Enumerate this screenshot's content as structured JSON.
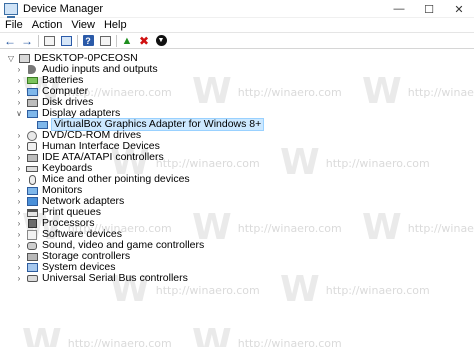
{
  "window": {
    "title": "Device Manager",
    "controls": {
      "minimize": "—",
      "maximize": "☐",
      "close": "✕"
    }
  },
  "menubar": {
    "items": [
      {
        "label": "File"
      },
      {
        "label": "Action"
      },
      {
        "label": "View"
      },
      {
        "label": "Help"
      }
    ]
  },
  "toolbar": {
    "buttons": [
      "back-arrow-icon",
      "forward-arrow-icon",
      "properties-icon",
      "show-hidden-icon",
      "help-icon",
      "scan-hardware-icon",
      "update-driver-icon",
      "uninstall-icon",
      "disable-icon"
    ]
  },
  "tree": {
    "root": "DESKTOP-0PCEOSN",
    "categories": [
      {
        "label": "Audio inputs and outputs",
        "icon": "speaker-icon"
      },
      {
        "label": "Batteries",
        "icon": "battery-icon"
      },
      {
        "label": "Computer",
        "icon": "computer-icon"
      },
      {
        "label": "Disk drives",
        "icon": "disk-icon"
      },
      {
        "label": "Display adapters",
        "icon": "display-adapter-icon"
      },
      {
        "label": "VirtualBox Graphics Adapter for Windows 8+",
        "icon": "display-adapter-icon"
      },
      {
        "label": "DVD/CD-ROM drives",
        "icon": "cdrom-icon"
      },
      {
        "label": "Human Interface Devices",
        "icon": "hid-icon"
      },
      {
        "label": "IDE ATA/ATAPI controllers",
        "icon": "ide-icon"
      },
      {
        "label": "Keyboards",
        "icon": "keyboard-icon"
      },
      {
        "label": "Mice and other pointing devices",
        "icon": "mouse-icon"
      },
      {
        "label": "Monitors",
        "icon": "monitor-icon"
      },
      {
        "label": "Network adapters",
        "icon": "network-icon"
      },
      {
        "label": "Print queues",
        "icon": "printer-icon"
      },
      {
        "label": "Processors",
        "icon": "processor-icon"
      },
      {
        "label": "Software devices",
        "icon": "software-icon"
      },
      {
        "label": "Sound, video and game controllers",
        "icon": "sound-icon"
      },
      {
        "label": "Storage controllers",
        "icon": "storage-icon"
      },
      {
        "label": "System devices",
        "icon": "system-icon"
      },
      {
        "label": "Universal Serial Bus controllers",
        "icon": "usb-icon"
      }
    ]
  },
  "watermark": {
    "text": "http://winaero.com"
  },
  "colors": {
    "selection": "#cce8ff",
    "selection_border": "#99d1ff"
  }
}
